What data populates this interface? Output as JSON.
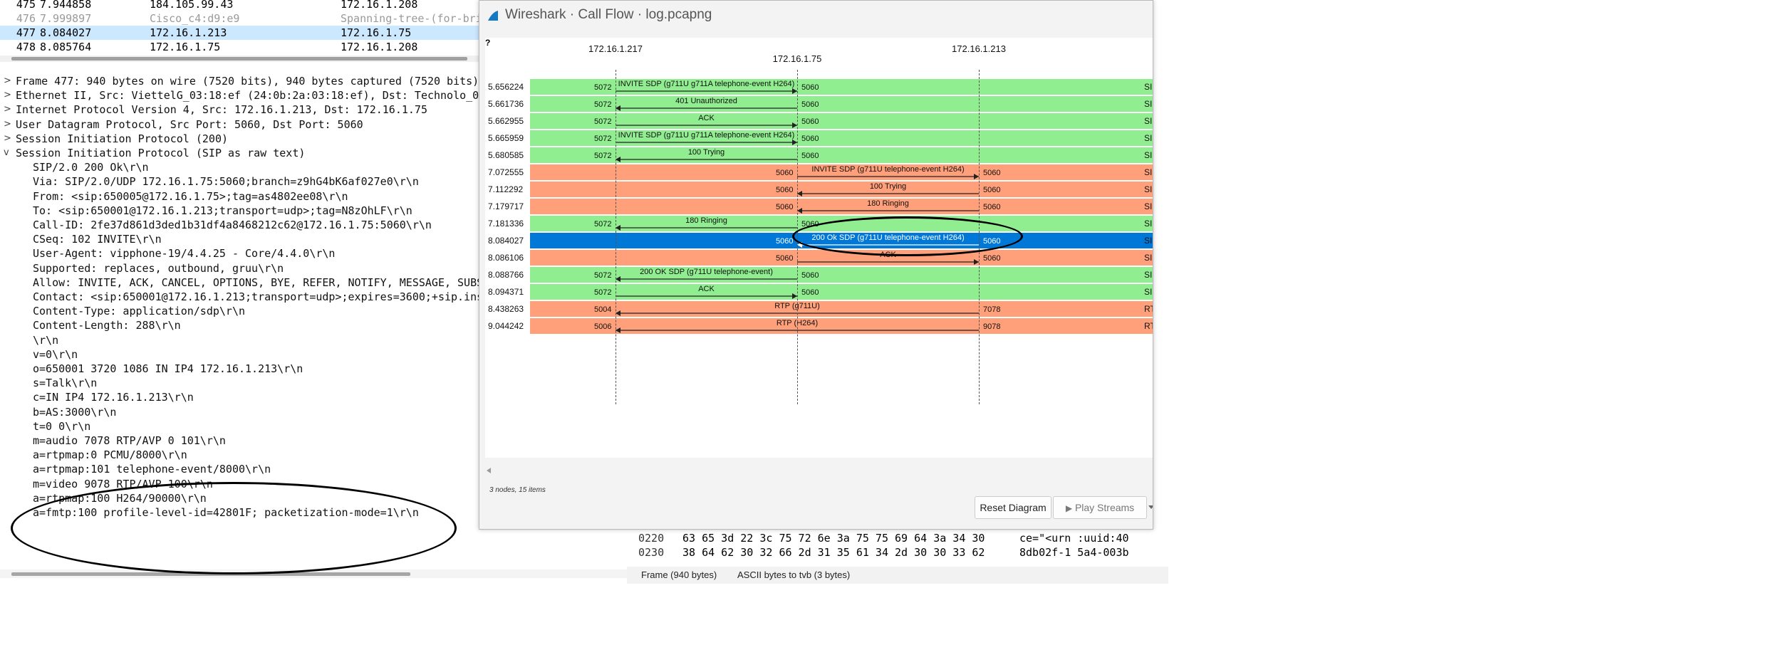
{
  "packet_list": {
    "rows": [
      {
        "no": "475",
        "time": "7.944858",
        "src": "184.105.99.43",
        "dst": "172.16.1.208",
        "style": "normal"
      },
      {
        "no": "476",
        "time": "7.999897",
        "src": "Cisco_c4:d9:e9",
        "dst": "Spanning-tree-(for-bri",
        "style": "muted"
      },
      {
        "no": "477",
        "time": "8.084027",
        "src": "172.16.1.213",
        "dst": "172.16.1.75",
        "style": "selected"
      },
      {
        "no": "478",
        "time": "8.085764",
        "src": "172.16.1.75",
        "dst": "172.16.1.208",
        "style": "normal"
      }
    ]
  },
  "details": {
    "tree": [
      {
        "caret": ">",
        "text": "Frame 477: 940 bytes on wire (7520 bits), 940 bytes captured (7520 bits)"
      },
      {
        "caret": ">",
        "text": "Ethernet II, Src: ViettelG_03:18:ef (24:0b:2a:03:18:ef), Dst: Technolo_0"
      },
      {
        "caret": ">",
        "text": "Internet Protocol Version 4, Src: 172.16.1.213, Dst: 172.16.1.75"
      },
      {
        "caret": ">",
        "text": "User Datagram Protocol, Src Port: 5060, Dst Port: 5060"
      },
      {
        "caret": ">",
        "text": "Session Initiation Protocol (200)"
      },
      {
        "caret": "v",
        "text": "Session Initiation Protocol (SIP as raw text)"
      }
    ],
    "sip_lines": [
      "SIP/2.0 200 Ok\\r\\n",
      "Via: SIP/2.0/UDP 172.16.1.75:5060;branch=z9hG4bK6af027e0\\r\\n",
      "From: <sip:650005@172.16.1.75>;tag=as4802ee08\\r\\n",
      "To: <sip:650001@172.16.1.213;transport=udp>;tag=N8zOhLF\\r\\n",
      "Call-ID: 2fe37d861d3ded1b31df4a8468212c62@172.16.1.75:5060\\r\\n",
      "CSeq: 102 INVITE\\r\\n",
      "User-Agent: vipphone-19/4.4.25 - Core/4.4.0\\r\\n",
      "Supported: replaces, outbound, gruu\\r\\n",
      "Allow: INVITE, ACK, CANCEL, OPTIONS, BYE, REFER, NOTIFY, MESSAGE, SUBS",
      "Contact: <sip:650001@172.16.1.213;transport=udp>;expires=3600;+sip.ins",
      "Content-Type: application/sdp\\r\\n",
      "Content-Length: 288\\r\\n",
      "\\r\\n",
      "v=0\\r\\n",
      "o=650001 3720 1086 IN IP4 172.16.1.213\\r\\n",
      "s=Talk\\r\\n",
      "c=IN IP4 172.16.1.213\\r\\n",
      "b=AS:3000\\r\\n",
      "t=0 0\\r\\n",
      "m=audio 7078 RTP/AVP 0 101\\r\\n",
      "a=rtpmap:0 PCMU/8000\\r\\n",
      "a=rtpmap:101 telephone-event/8000\\r\\n",
      "m=video 9078 RTP/AVP 100\\r\\n",
      "a=rtpmap:100 H264/90000\\r\\n",
      "a=fmtp:100 profile-level-id=42801F; packetization-mode=1\\r\\n"
    ]
  },
  "hex_pane": {
    "rows": [
      {
        "offset": "0220",
        "bytes": "63 65 3d 22 3c 75 72 6e  3a 75 75 69 64 3a 34 30",
        "ascii": "ce=\"<urn :uuid:40"
      },
      {
        "offset": "0230",
        "bytes": "38 64 62 30 32 66 2d 31  35 61 34 2d 30 30 33 62",
        "ascii": "8db02f-1 5a4-003b"
      }
    ]
  },
  "status_bar": {
    "frame_tab": "Frame (940 bytes)",
    "ascii_tab": "ASCII bytes to tvb (3 bytes)"
  },
  "call_flow": {
    "window_title": "Wireshark · Call Flow · log.pcapng",
    "corner_glyph": "?",
    "nodes": [
      "172.16.1.217",
      "172.16.1.75",
      "172.16.1.213"
    ],
    "items": [
      {
        "time": "5.656224",
        "from": 0,
        "to": 1,
        "label": "INVITE SDP (g711U g711A telephone-event H264)",
        "from_port": "5072",
        "to_port": "5060",
        "color": "green",
        "proto": "SIP"
      },
      {
        "time": "5.661736",
        "from": 1,
        "to": 0,
        "label": "401 Unauthorized",
        "from_port": "5060",
        "to_port": "5072",
        "color": "green",
        "proto": "SIP"
      },
      {
        "time": "5.662955",
        "from": 0,
        "to": 1,
        "label": "ACK",
        "from_port": "5072",
        "to_port": "5060",
        "color": "green",
        "proto": "SIP"
      },
      {
        "time": "5.665959",
        "from": 0,
        "to": 1,
        "label": "INVITE SDP (g711U g711A telephone-event H264)",
        "from_port": "5072",
        "to_port": "5060",
        "color": "green",
        "proto": "SIP"
      },
      {
        "time": "5.680585",
        "from": 1,
        "to": 0,
        "label": "100 Trying",
        "from_port": "5060",
        "to_port": "5072",
        "color": "green",
        "proto": "SIP"
      },
      {
        "time": "7.072555",
        "from": 1,
        "to": 2,
        "label": "INVITE SDP (g711U telephone-event H264)",
        "from_port": "5060",
        "to_port": "5060",
        "color": "orange",
        "proto": "SIP"
      },
      {
        "time": "7.112292",
        "from": 2,
        "to": 1,
        "label": "100 Trying",
        "from_port": "5060",
        "to_port": "5060",
        "color": "orange",
        "proto": "SIP"
      },
      {
        "time": "7.179717",
        "from": 2,
        "to": 1,
        "label": "180 Ringing",
        "from_port": "5060",
        "to_port": "5060",
        "color": "orange",
        "proto": "SIP"
      },
      {
        "time": "7.181336",
        "from": 1,
        "to": 0,
        "label": "180 Ringing",
        "from_port": "5060",
        "to_port": "5072",
        "color": "green",
        "proto": "SIP"
      },
      {
        "time": "8.084027",
        "from": 2,
        "to": 1,
        "label": "200 Ok SDP (g711U telephone-event H264)",
        "from_port": "5060",
        "to_port": "5060",
        "color": "selected",
        "proto": "SIP"
      },
      {
        "time": "8.086106",
        "from": 1,
        "to": 2,
        "label": "ACK",
        "from_port": "5060",
        "to_port": "5060",
        "color": "orange",
        "proto": "SIP"
      },
      {
        "time": "8.088766",
        "from": 1,
        "to": 0,
        "label": "200 OK SDP (g711U telephone-event)",
        "from_port": "5060",
        "to_port": "5072",
        "color": "green",
        "proto": "SIP"
      },
      {
        "time": "8.094371",
        "from": 0,
        "to": 1,
        "label": "ACK",
        "from_port": "5072",
        "to_port": "5060",
        "color": "green",
        "proto": "SIP"
      },
      {
        "time": "8.438263",
        "from": 2,
        "to": 0,
        "label": "RTP (g711U)",
        "from_port": "7078",
        "to_port": "5004",
        "color": "orange",
        "proto": "RTP"
      },
      {
        "time": "9.044242",
        "from": 2,
        "to": 0,
        "label": "RTP (H264)",
        "from_port": "9078",
        "to_port": "5006",
        "color": "orange",
        "proto": "RTP"
      }
    ],
    "summary": "3 nodes, 15 items",
    "buttons": {
      "reset": "Reset Diagram",
      "play": "Play Streams"
    }
  },
  "colors": {
    "selected_blue": "#0078d7",
    "sip_green": "#90ee90",
    "call_orange": "#ffa07a",
    "packet_selected": "#cce8ff"
  }
}
